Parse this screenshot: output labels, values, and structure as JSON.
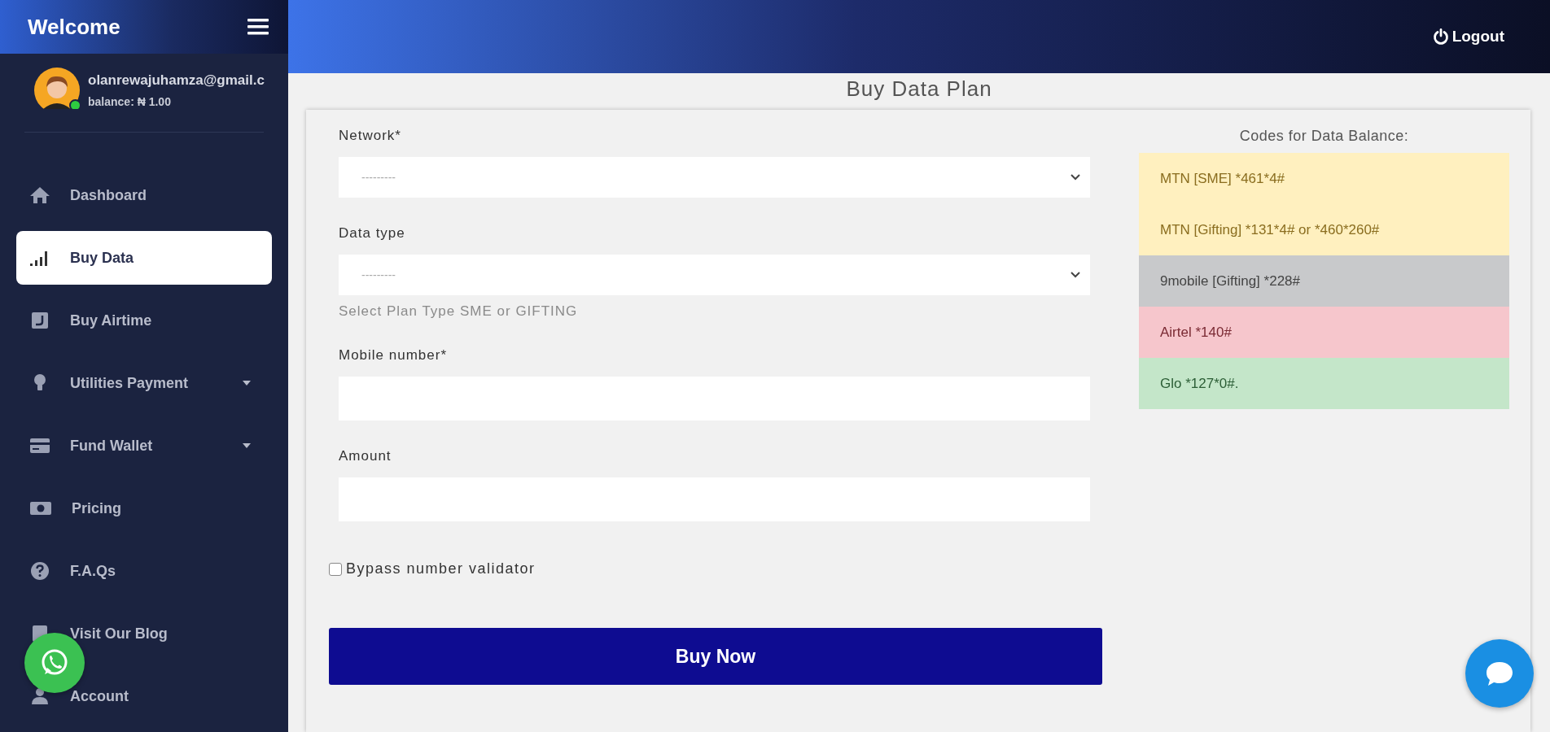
{
  "brand": {
    "title": "Welcome"
  },
  "topbar": {
    "logout": "Logout"
  },
  "user": {
    "email": "olanrewajuhamza@gmail.c",
    "balance": "balance: ₦ 1.00",
    "online": true
  },
  "sidebar": {
    "items": [
      {
        "label": "Dashboard",
        "kind": "home",
        "selected": false,
        "expandable": false
      },
      {
        "label": "Buy Data",
        "kind": "signal",
        "selected": true,
        "expandable": false
      },
      {
        "label": "Buy Airtime",
        "kind": "phone",
        "selected": false,
        "expandable": false
      },
      {
        "label": "Utilities Payment",
        "kind": "bulb",
        "selected": false,
        "expandable": true
      },
      {
        "label": "Fund Wallet",
        "kind": "card",
        "selected": false,
        "expandable": true
      },
      {
        "label": "Pricing",
        "kind": "money",
        "selected": false,
        "expandable": false
      },
      {
        "label": "F.A.Qs",
        "kind": "question",
        "selected": false,
        "expandable": false
      },
      {
        "label": "Visit Our Blog",
        "kind": "blog",
        "selected": false,
        "expandable": false
      },
      {
        "label": "Account",
        "kind": "user",
        "selected": false,
        "expandable": false
      }
    ]
  },
  "page": {
    "title": "Buy Data Plan"
  },
  "form": {
    "fields": [
      {
        "kind": "select",
        "label": "Network*",
        "value": "---------"
      },
      {
        "kind": "select",
        "label": "Data type",
        "value": "---------",
        "help": "Select Plan Type SME or GIFTING"
      },
      {
        "kind": "text",
        "label": "Mobile number*"
      },
      {
        "kind": "text",
        "label": "Amount"
      }
    ],
    "bypass": {
      "label": "Bypass number validator",
      "checked": false
    },
    "submit": "Buy Now"
  },
  "codes": {
    "title": "Codes for Data Balance:",
    "items": [
      {
        "text": "MTN [SME] *461*4#",
        "color": "#fff0bf"
      },
      {
        "text": "MTN [Gifting] *131*4# or *460*260#",
        "color": "#fff0bf"
      },
      {
        "text": "9mobile [Gifting] *228#",
        "color": "#c8c9cb"
      },
      {
        "text": "Airtel *140#",
        "color": "#f6c6cc"
      },
      {
        "text": "Glo *127*0#.",
        "color": "#c4e6c9"
      }
    ]
  }
}
